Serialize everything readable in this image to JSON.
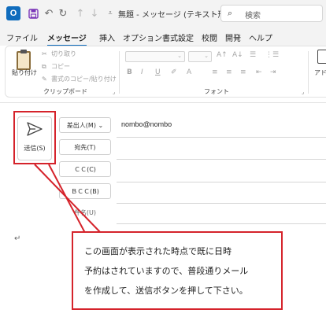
{
  "titlebar": {
    "app_logo": "O",
    "icons": [
      "outlook-icon",
      "save-icon",
      "undo-icon",
      "redo-icon",
      "up-arrow-icon",
      "down-arrow-icon",
      "customize-icon"
    ],
    "title": "無題 - メッセージ (テキスト形",
    "search_placeholder": "検索"
  },
  "tabs": [
    "ファイル",
    "メッセージ",
    "挿入",
    "オプション",
    "書式設定",
    "校閲",
    "開発",
    "ヘルプ"
  ],
  "active_tab": "メッセージ",
  "ribbon": {
    "paste_label": "貼り付け",
    "cut_label": "切り取り",
    "copy_label": "コピー",
    "format_painter_label": "書式のコピー/貼り付け",
    "clipboard_group": "クリップボード",
    "font_group": "フォント",
    "font_buttons": [
      "B",
      "I",
      "U",
      "A↑",
      "A↓"
    ],
    "partial_label": "アドレ"
  },
  "compose": {
    "send_label": "送信(S)",
    "from_button": "差出人(M) ⌄",
    "from_value": "nombo@nombo",
    "to_button": "宛先(T)",
    "cc_button": "ＣＣ(C)",
    "bcc_button": "ＢＣＣ(B)",
    "subject_label": "件名(U)",
    "cursor": "↵"
  },
  "callout": {
    "lines": [
      "この画面が表示された時点で既に日時",
      "予約はされていますので、普段通りメール",
      "を作成して、送信ボタンを押して下さい。"
    ]
  },
  "colors": {
    "accent": "#0f6cbd",
    "highlight_red": "#d5232b",
    "titlebar_bg": "#f3f3f3"
  }
}
